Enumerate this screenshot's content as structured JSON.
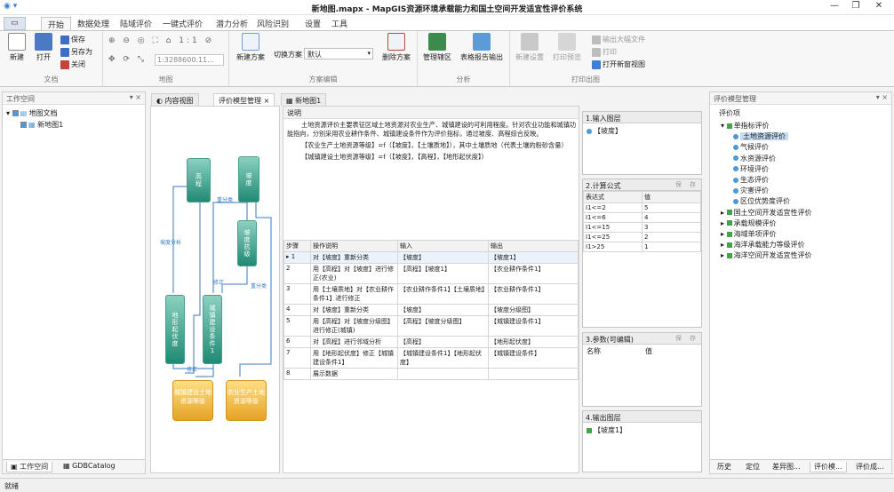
{
  "window": {
    "title": "新地图.mapx - MapGIS资源环境承载能力和国土空间开发适宜性评价系统",
    "minimize": "—",
    "restore": "❐",
    "close": "✕"
  },
  "ribbon_tabs": [
    "开始",
    "数据处理",
    "陆域评价",
    "一键式评价",
    "潜力分析",
    "风险识别",
    "设置",
    "工具"
  ],
  "file_tab": "▭",
  "groups": {
    "doc": {
      "label": "文档",
      "new": "新建",
      "open": "打开",
      "save": "保存",
      "saveas": "另存为",
      "close": "关闭"
    },
    "map": {
      "label": "地图",
      "scale": "1:3288600.11...",
      "one_to_one": "1:1"
    },
    "scheme": {
      "label": "方案编辑",
      "new_scheme": "新建方案",
      "switch_label": "切换方案",
      "switch_value": "默认",
      "delete_scheme": "删除方案"
    },
    "analysis": {
      "label": "分析",
      "manage": "管理辖区",
      "report": "表格报告输出"
    },
    "print": {
      "label": "打印出图",
      "new_layout": "新建设置",
      "print_preview": "打印预览",
      "export_large": "输出大幅文件",
      "print": "打印",
      "open_layout": "打开新窗视图"
    }
  },
  "workspace": {
    "title": "工作空间",
    "pin": "▾ ⨯",
    "tree": [
      "地图文档",
      "新地图1"
    ],
    "bottom_tabs": [
      "工作空间",
      "GDBCatalog"
    ]
  },
  "doc_tabs": [
    "内容视图",
    "评价模型管理",
    "新地图1"
  ],
  "flow": {
    "nodes": [
      "高程",
      "坡度",
      "坡度抗级",
      "地形起伏度",
      "城镇建设条件1",
      "城镇建设土地资源等级",
      "农业生产土地资源等级"
    ],
    "labels": [
      "坡度分析",
      "重分类",
      "修正",
      "修正",
      "重分类"
    ]
  },
  "description": {
    "header": "说明",
    "lines": [
      "土地资源评价主要表征区域土地资源对农业生产、城镇建设的可利用程度。针对农业功能和城镇功能指向，分别采用农业耕作条件、城镇建设条件作为评价指标，通过坡度、高程综合反映。",
      "【农业生产土地资源等级】=f（【坡度】，【土壤质地】），其中土壤质地（代表土壤的粉砂含量）",
      "【城镇建设土地资源等级】=f（【坡度】，【高程】，【地形起伏度】）"
    ]
  },
  "steps": {
    "headers": [
      "步骤",
      "操作说明",
      "输入",
      "输出"
    ],
    "rows": [
      [
        "1",
        "对【坡度】重新分类",
        "【坡度】",
        "【坡度1】"
      ],
      [
        "2",
        "用【高程】对【坡度】进行修正(农业)",
        "【高程】【坡度1】",
        "【农业耕作条件1】"
      ],
      [
        "3",
        "用【土壤质地】对【农业耕作条件1】进行修正",
        "【农业耕作条件1】【土壤质地】",
        "【农业耕作条件1】"
      ],
      [
        "4",
        "对【坡度】重新分类",
        "【坡度】",
        "【坡度分级图】"
      ],
      [
        "5",
        "用【高程】对【坡度分级图】进行修正(城镇)",
        "【高程】【坡度分级图】",
        "【城镇建设条件1】"
      ],
      [
        "6",
        "对【高程】进行邻域分析",
        "【高程】",
        "【地形起伏度】"
      ],
      [
        "7",
        "用【地形起伏度】修正【城镇建设条件1】",
        "【城镇建设条件1】【地形起伏度】",
        "【城镇建设条件】"
      ],
      [
        "8",
        "展示数据",
        "",
        ""
      ]
    ]
  },
  "input_layers": {
    "title": "1.输入图层",
    "items": [
      "【坡度】"
    ]
  },
  "formula": {
    "title": "2.计算公式",
    "btns": [
      "保",
      "存"
    ],
    "headers": [
      "表达式",
      "值"
    ],
    "rows": [
      [
        "I1<=2",
        "5"
      ],
      [
        "I1<=6",
        "4"
      ],
      [
        "I1<=15",
        "3"
      ],
      [
        "I1<=25",
        "2"
      ],
      [
        "I1>25",
        "1"
      ]
    ]
  },
  "params": {
    "title": "3.参数(可编辑)",
    "btns": [
      "保",
      "存"
    ],
    "headers": [
      "名称",
      "值"
    ]
  },
  "output_layers": {
    "title": "4.输出图层",
    "items": [
      "【坡度1】"
    ]
  },
  "model_mgmt": {
    "title": "评价模型管理",
    "pin": "▾ ⨯",
    "root": "评价项",
    "items": [
      {
        "label": "单指标评价",
        "level": 1,
        "expanded": true
      },
      {
        "label": "土地资源评价",
        "level": 2,
        "selected": true
      },
      {
        "label": "气候评价",
        "level": 2
      },
      {
        "label": "水资源评价",
        "level": 2
      },
      {
        "label": "环境评价",
        "level": 2
      },
      {
        "label": "生态评价",
        "level": 2
      },
      {
        "label": "灾害评价",
        "level": 2
      },
      {
        "label": "区位优势度评价",
        "level": 2
      },
      {
        "label": "国土空间开发适宜性评价",
        "level": 1
      },
      {
        "label": "承载规模评价",
        "level": 1
      },
      {
        "label": "海域单项评价",
        "level": 1
      },
      {
        "label": "海洋承载能力等级评价",
        "level": 1
      },
      {
        "label": "海洋空间开发适宜性评价",
        "level": 1
      }
    ],
    "bottom_tabs": [
      "历史",
      "定位",
      "差异图...",
      "评价模...",
      "评价成..."
    ]
  },
  "status": "就绪",
  "colors": {
    "accent": "#3e7fd1",
    "node_green": "#2a9b80",
    "node_orange": "#f0b43a"
  }
}
